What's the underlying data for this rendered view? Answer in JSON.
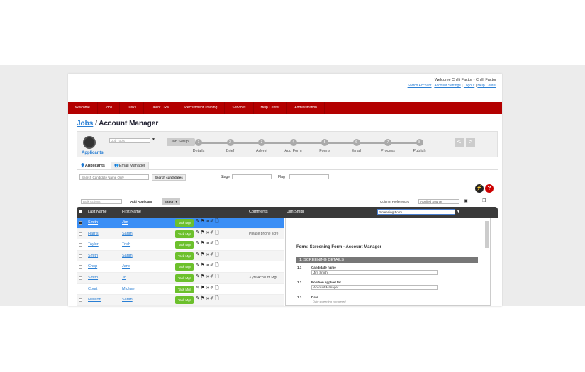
{
  "header": {
    "welcome": "Welcome Chilli Factor - Chilli Factor",
    "links": [
      "Switch Account",
      "Account Settings",
      "Logout",
      "Help Center"
    ]
  },
  "nav": [
    "Welcome",
    "Jobs",
    "Tasks",
    "Talent CRM",
    "Recruitment Training",
    "Services",
    "Help Center",
    "Administration"
  ],
  "breadcrumb": {
    "link": "Jobs",
    "current": " / Account Manager"
  },
  "panel": {
    "applicants_label": "Applicants",
    "job_tools_placeholder": "Job Tools",
    "job_setup": "Job Setup",
    "steps": [
      {
        "n": "1",
        "label": "Details"
      },
      {
        "n": "2",
        "label": "Brief"
      },
      {
        "n": "3",
        "label": "Advert"
      },
      {
        "n": "4",
        "label": "App Form"
      },
      {
        "n": "5",
        "label": "Forms"
      },
      {
        "n": "6",
        "label": "Email"
      },
      {
        "n": "7",
        "label": "Process"
      },
      {
        "n": "8",
        "label": "Publish"
      }
    ],
    "prev": "<",
    "next": ">"
  },
  "tabs": [
    "Applicants",
    "Email Manager"
  ],
  "filters": {
    "search_placeholder": "Search Candidate Name Only",
    "search_button": "Search candidates",
    "stage_label": "Stage",
    "flag_label": "Flag"
  },
  "toolbar": {
    "bulk_actions": "Bulk Actions",
    "add_applicant": "Add Applicant",
    "export": "Export ▾",
    "column_prefs_label": "Column Preferences",
    "column_prefs_value": "Applied Source"
  },
  "grid": {
    "headers": [
      "Last Name",
      "First Name",
      "Comments"
    ],
    "task_label": "Task Mgr",
    "rows": [
      {
        "last": "Smith",
        "first": "Jim",
        "comment": "",
        "checked": true
      },
      {
        "last": "Harris",
        "first": "Sarah",
        "comment": "Please phone scre"
      },
      {
        "last": "Taylor",
        "first": "Trish",
        "comment": ""
      },
      {
        "last": "Smith",
        "first": "Sarah",
        "comment": ""
      },
      {
        "last": "Chop",
        "first": "Jane",
        "comment": ""
      },
      {
        "last": "Smith",
        "first": "Jo",
        "comment": "3 yrs Account Mgr"
      },
      {
        "last": "Court",
        "first": "Michael",
        "comment": ""
      },
      {
        "last": "Newton",
        "first": "Sarah",
        "comment": ""
      }
    ]
  },
  "detail": {
    "name": "Jim Smith",
    "form_select": "Screening Form",
    "form_title": "Form: Screening Form - Account Manager",
    "section": "1.  SCREENING DETAILS",
    "fields": [
      {
        "n": "1.1",
        "label": "Candidate name",
        "value": "Jim Smith"
      },
      {
        "n": "1.2",
        "label": "Position applied for",
        "value": "Account Manager"
      },
      {
        "n": "1.3",
        "label": "Date",
        "hint": "Date screening completed"
      }
    ]
  },
  "colors": {
    "nav": "#b30000",
    "selected_row": "#3a8ef5",
    "task_button": "#6cc02c"
  }
}
